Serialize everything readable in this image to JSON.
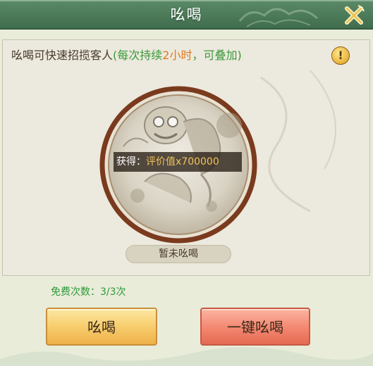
{
  "window": {
    "title": "吆喝"
  },
  "description": {
    "main": "吆喝可快速招揽客人",
    "note_prefix": "(每次持续",
    "note_duration": "2小时",
    "note_suffix": "，可叠加)"
  },
  "reward": {
    "label": "获得：",
    "value": "评价值x700000"
  },
  "status": {
    "text": "暂未吆喝"
  },
  "free_count": {
    "text": "免费次数：3/3次"
  },
  "buttons": {
    "shout": "吆喝",
    "one_click_shout": "一键吆喝"
  },
  "colors": {
    "title_bar": "#4b7a58",
    "ring": "#7a3a1e",
    "free_count": "#2d9a3a",
    "shout_button": "#f7cd6d",
    "one_click_button": "#f3866f"
  },
  "icons": [
    "close-icon",
    "info-icon",
    "lion-dance-icon"
  ]
}
